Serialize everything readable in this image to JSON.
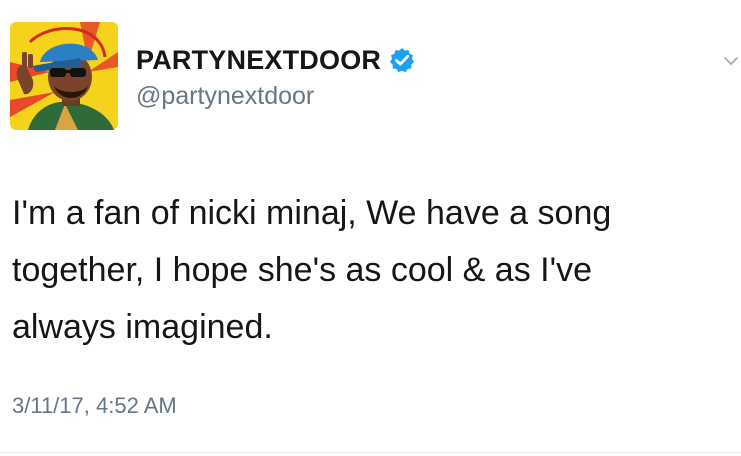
{
  "tweet": {
    "author": {
      "display_name": "PARTYNEXTDOOR",
      "handle": "@partynextdoor",
      "verified": true,
      "avatar_icon": "cartoon-portrait-avatar"
    },
    "text": "I'm a fan of nicki minaj, We have a song\ntogether, I hope she's as cool & as I've\nalways imagined.",
    "timestamp": "3/11/17, 4:52 AM",
    "menu_icon": "chevron-down-icon"
  },
  "colors": {
    "verified_badge": "#1da1f2",
    "secondary_text": "#657786",
    "primary_text": "#14171a",
    "avatar_background": "#f5d21c"
  }
}
